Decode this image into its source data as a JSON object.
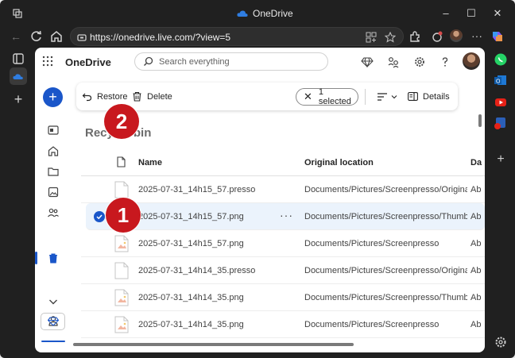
{
  "window": {
    "title": "OneDrive",
    "controls": {
      "minimize": "–",
      "maximize": "☐",
      "close": "✕"
    }
  },
  "browser": {
    "url": "https://onedrive.live.com/?view=5"
  },
  "app": {
    "brand": "OneDrive",
    "search_placeholder": "Search everything"
  },
  "commandbar": {
    "restore": "Restore",
    "delete": "Delete",
    "selected": "1 selected",
    "details": "Details"
  },
  "page": {
    "title": "Recycle bin"
  },
  "table": {
    "headers": {
      "name": "Name",
      "location": "Original location",
      "date": "Da"
    },
    "rows": [
      {
        "name": "2025-07-31_14h15_57.presso",
        "location": "Documents/Pictures/Screenpresso/Originals",
        "date": "Ab",
        "kind": "doc",
        "selected": false
      },
      {
        "name": "2025-07-31_14h15_57.png",
        "location": "Documents/Pictures/Screenpresso/Thumbn...",
        "date": "Ab",
        "kind": "image",
        "selected": true
      },
      {
        "name": "2025-07-31_14h15_57.png",
        "location": "Documents/Pictures/Screenpresso",
        "date": "Ab",
        "kind": "image",
        "selected": false
      },
      {
        "name": "2025-07-31_14h14_35.presso",
        "location": "Documents/Pictures/Screenpresso/Originals",
        "date": "Ab",
        "kind": "doc",
        "selected": false
      },
      {
        "name": "2025-07-31_14h14_35.png",
        "location": "Documents/Pictures/Screenpresso/Thumbn...",
        "date": "Ab",
        "kind": "image",
        "selected": false
      },
      {
        "name": "2025-07-31_14h14_35.png",
        "location": "Documents/Pictures/Screenpresso",
        "date": "Ab",
        "kind": "image",
        "selected": false
      }
    ]
  },
  "annotations": {
    "marker1": "1",
    "marker2": "2"
  },
  "colors": {
    "accent": "#1a56c9",
    "marker": "#c8181e",
    "selected_row": "#ebf3fc"
  }
}
